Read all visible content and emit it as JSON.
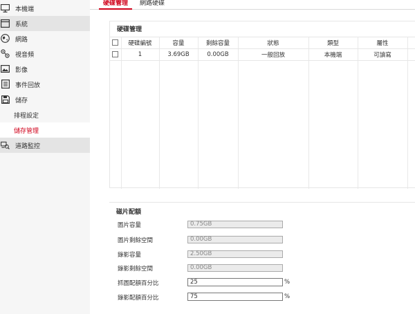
{
  "sidebar": {
    "items": [
      {
        "label": "本機端",
        "icon": "monitor-icon"
      },
      {
        "label": "系統",
        "icon": "window-icon"
      },
      {
        "label": "網路",
        "icon": "globe-icon"
      },
      {
        "label": "視音頻",
        "icon": "audio-video-icon"
      },
      {
        "label": "影像",
        "icon": "image-icon"
      },
      {
        "label": "事件回放",
        "icon": "event-list-icon"
      },
      {
        "label": "儲存",
        "icon": "save-icon"
      },
      {
        "label": "排程設定"
      },
      {
        "label": "儲存管理"
      },
      {
        "label": "道路監控",
        "icon": "road-monitor-icon"
      }
    ]
  },
  "tabs": [
    {
      "label": "硬碟管理"
    },
    {
      "label": "網路硬碟"
    }
  ],
  "disk_panel": {
    "title": "硬碟管理",
    "columns": [
      "硬碟編號",
      "容量",
      "剩餘容量",
      "狀態",
      "類型",
      "屬性"
    ],
    "rows": [
      {
        "id": "1",
        "capacity": "3.69GB",
        "free": "0.00GB",
        "status": "一般回放",
        "type": "本機端",
        "property": "可讀寫"
      }
    ]
  },
  "quota_panel": {
    "title": "磁片配額",
    "fields": [
      {
        "label": "圖片容量",
        "value": "0.75GB"
      },
      {
        "label": "圖片剩餘空間",
        "value": "0.00GB"
      },
      {
        "label": "錄影容量",
        "value": "2.50GB"
      },
      {
        "label": "錄影剩餘空間",
        "value": "0.00GB"
      },
      {
        "label": "抓圖配額百分比",
        "value": "25",
        "unit": "%"
      },
      {
        "label": "錄影配額百分比",
        "value": "75",
        "unit": "%"
      }
    ]
  },
  "colors": {
    "accent": "#d0021b",
    "sidebar_bg": "#f6f6f6",
    "sidebar_highlight": "#e4e4e4"
  }
}
